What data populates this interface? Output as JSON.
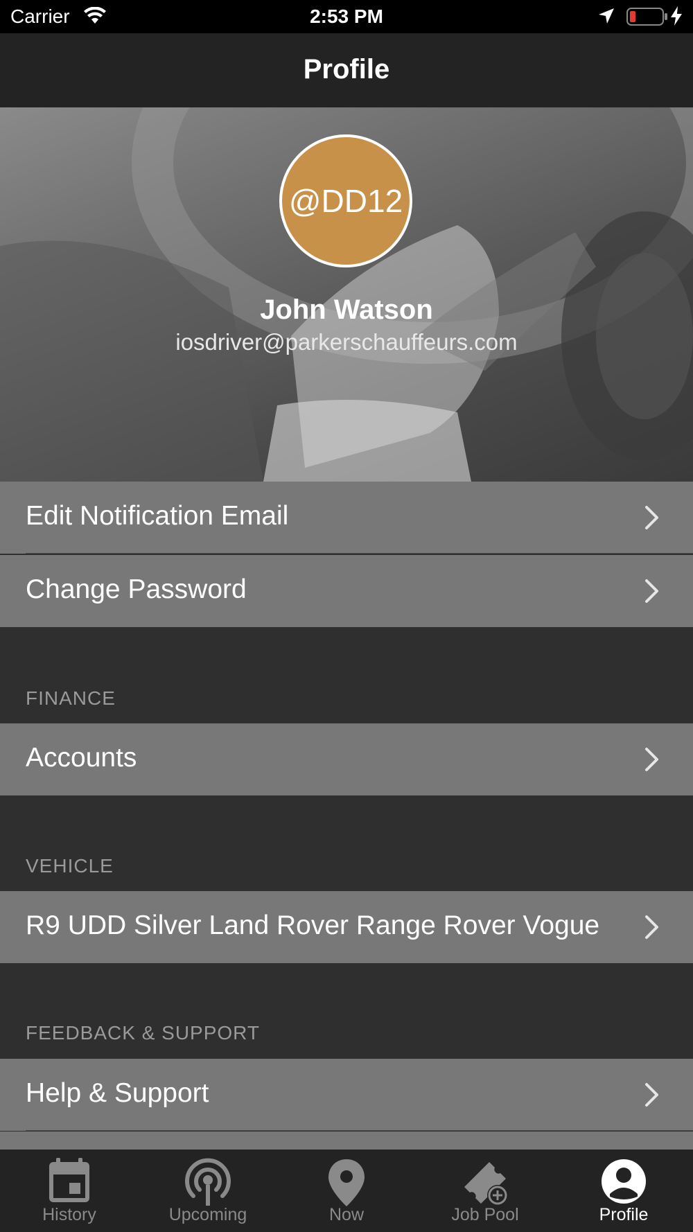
{
  "status_bar": {
    "carrier": "Carrier",
    "time": "2:53 PM",
    "battery_color": "#e53935"
  },
  "nav": {
    "title": "Profile"
  },
  "profile": {
    "avatar_text": "@DD12",
    "avatar_color": "#c8914a",
    "name": "John Watson",
    "email": "iosdriver@parkerschauffeurs.com"
  },
  "account_rows": [
    {
      "label": "Edit Notification Email"
    },
    {
      "label": "Change Password"
    }
  ],
  "finance": {
    "header": "FINANCE",
    "rows": [
      {
        "label": "Accounts"
      }
    ]
  },
  "vehicle": {
    "header": "VEHICLE",
    "rows": [
      {
        "label": "R9 UDD Silver Land Rover Range Rover Vogue"
      }
    ]
  },
  "support": {
    "header": "FEEDBACK & SUPPORT",
    "rows": [
      {
        "label": "Help & Support"
      }
    ]
  },
  "tabs": [
    {
      "label": "History",
      "icon": "calendar-icon",
      "active": false
    },
    {
      "label": "Upcoming",
      "icon": "broadcast-icon",
      "active": false
    },
    {
      "label": "Now",
      "icon": "map-pin-icon",
      "active": false
    },
    {
      "label": "Job Pool",
      "icon": "ticket-add-icon",
      "active": false
    },
    {
      "label": "Profile",
      "icon": "account-circle-icon",
      "active": true
    }
  ]
}
